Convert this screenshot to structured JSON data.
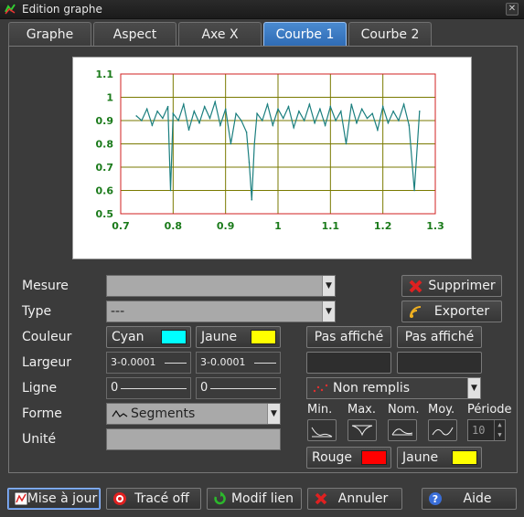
{
  "window": {
    "title": "Edition graphe"
  },
  "tabs": [
    {
      "label": "Graphe",
      "active": false
    },
    {
      "label": "Aspect",
      "active": false
    },
    {
      "label": "Axe X",
      "active": false
    },
    {
      "label": "Courbe 1",
      "active": true
    },
    {
      "label": "Courbe 2",
      "active": false
    }
  ],
  "chart_data": {
    "type": "line",
    "xlim": [
      0.7,
      1.3
    ],
    "ylim": [
      0.5,
      1.1
    ],
    "x_ticks": [
      "0.7",
      "0.8",
      "0.9",
      "1",
      "1.1",
      "1.2",
      "1.3"
    ],
    "y_ticks": [
      "0.5",
      "0.6",
      "0.7",
      "0.8",
      "0.9",
      "1",
      "1.1"
    ],
    "grid": true,
    "series": [
      {
        "color": "#1b7f7f",
        "x": [
          0.73,
          0.74,
          0.75,
          0.76,
          0.77,
          0.78,
          0.79,
          0.795,
          0.8,
          0.81,
          0.82,
          0.83,
          0.84,
          0.85,
          0.86,
          0.87,
          0.88,
          0.89,
          0.9,
          0.91,
          0.92,
          0.93,
          0.94,
          0.945,
          0.95,
          0.955,
          0.96,
          0.97,
          0.98,
          0.99,
          1.0,
          1.01,
          1.02,
          1.03,
          1.04,
          1.05,
          1.06,
          1.07,
          1.08,
          1.09,
          1.1,
          1.11,
          1.12,
          1.13,
          1.14,
          1.15,
          1.16,
          1.17,
          1.18,
          1.19,
          1.2,
          1.21,
          1.22,
          1.23,
          1.24,
          1.25,
          1.26,
          1.27
        ],
        "y": [
          0.92,
          0.9,
          0.95,
          0.88,
          0.94,
          0.91,
          0.96,
          0.6,
          0.93,
          0.9,
          0.97,
          0.86,
          0.94,
          0.89,
          0.96,
          0.91,
          0.98,
          0.88,
          0.95,
          0.8,
          0.93,
          0.9,
          0.85,
          0.72,
          0.56,
          0.8,
          0.93,
          0.9,
          0.97,
          0.88,
          0.95,
          0.91,
          0.96,
          0.87,
          0.94,
          0.9,
          0.97,
          0.89,
          0.95,
          0.88,
          0.96,
          0.9,
          0.94,
          0.8,
          0.97,
          0.89,
          0.95,
          0.91,
          0.93,
          0.86,
          0.96,
          0.89,
          0.94,
          0.9,
          0.97,
          0.88,
          0.6,
          0.94
        ]
      }
    ]
  },
  "form": {
    "mesure_label": "Mesure",
    "mesure_value": "",
    "type_label": "Type",
    "type_value": "---",
    "couleur_label": "Couleur",
    "couleur1": {
      "name": "Cyan",
      "color": "#00ffff"
    },
    "couleur2": {
      "name": "Jaune",
      "color": "#ffff00"
    },
    "largeur_label": "Largeur",
    "largeur1": "3-0.0001",
    "largeur2": "3-0.0001",
    "ligne_label": "Ligne",
    "ligne1": "0",
    "ligne2": "0",
    "forme_label": "Forme",
    "forme_value": "Segments",
    "unite_label": "Unité",
    "unite_value": ""
  },
  "right": {
    "supprimer": "Supprimer",
    "exporter": "Exporter",
    "pas_affiche1": "Pas affiché",
    "pas_affiche2": "Pas affiché",
    "remplis_value": "Non remplis",
    "headers": {
      "min": "Min.",
      "max": "Max.",
      "nom": "Nom.",
      "moy": "Moy.",
      "periode": "Période"
    },
    "periode_value": "10",
    "rouge": {
      "name": "Rouge",
      "color": "#ff0000"
    },
    "jaune": {
      "name": "Jaune",
      "color": "#ffff00"
    }
  },
  "bottom": {
    "mise_a_jour": "Mise à jour",
    "trace_off": "Tracé off",
    "modif_lien": "Modif lien",
    "annuler": "Annuler",
    "aide": "Aide"
  }
}
